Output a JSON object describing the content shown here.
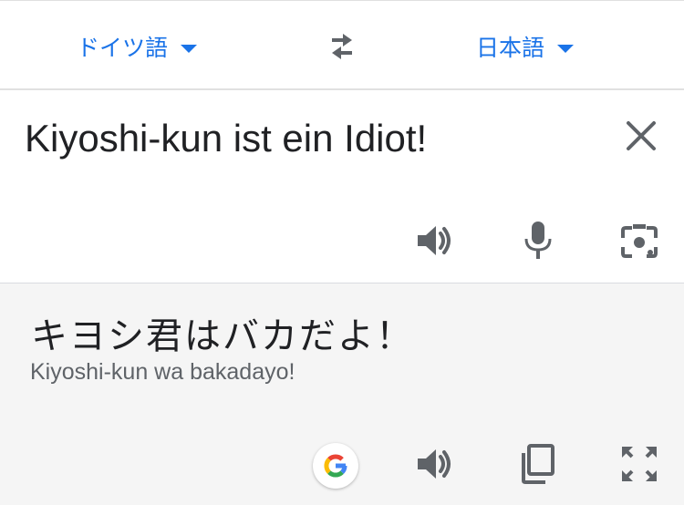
{
  "header": {
    "source_language": "ドイツ語",
    "target_language": "日本語"
  },
  "input": {
    "text": "Kiyoshi-kun ist ein Idiot!"
  },
  "output": {
    "translation": "キヨシ君はバカだよ！",
    "romanization": "Kiyoshi-kun wa bakadayo!"
  },
  "icons": {
    "swap": "swap-arrows-icon",
    "clear": "close-icon",
    "speaker": "speaker-icon",
    "microphone": "microphone-icon",
    "camera": "camera-icon",
    "google": "google-logo-icon",
    "copy": "copy-icon",
    "fullscreen": "fullscreen-icon"
  },
  "colors": {
    "accent": "#1a73e8",
    "icon": "#5f6368",
    "output_background": "#f5f5f5"
  }
}
